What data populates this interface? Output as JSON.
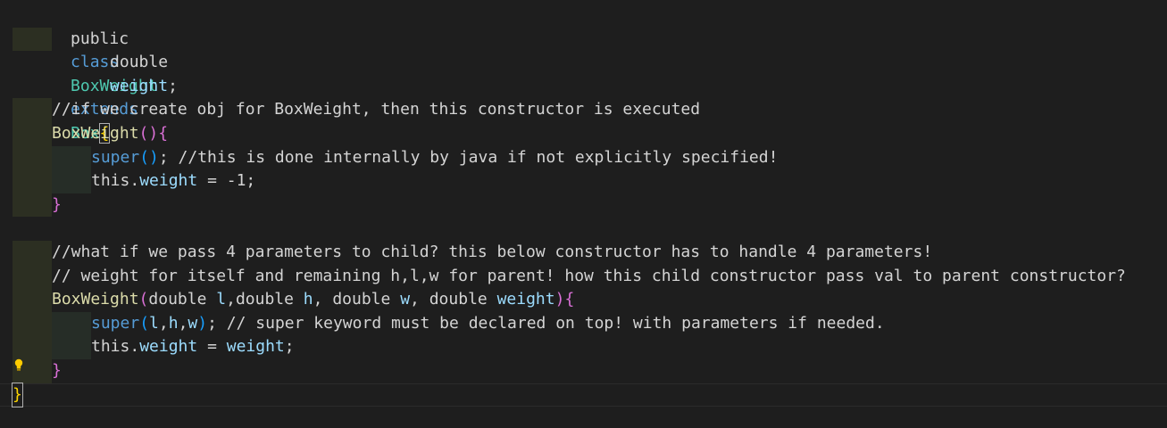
{
  "editor": {
    "lines": {
      "l0": {
        "kw1": "public",
        "kw2": "class",
        "cls": "BoxWeight",
        "kw3": "extends",
        "parent": "Box",
        "brace": "{"
      },
      "l1": {
        "type": "double",
        "name": "weight",
        "end": ";"
      },
      "l2": {},
      "l3": {},
      "l4": {
        "comment": "//if we create obj for BoxWeight, then this constructor is executed"
      },
      "l5": {
        "ctor": "BoxWeight",
        "paren": "()",
        "brace": "{"
      },
      "l6": {
        "super": "super",
        "paren": "()",
        "rest": "; //this is done internally by java if not explicitly specified!"
      },
      "l7": {
        "this": "this",
        "dot": ".",
        "field": "weight",
        "rest": " = -1;"
      },
      "l8": {
        "brace": "}"
      },
      "l9": {},
      "l10": {
        "comment": "//what if we pass 4 parameters to child? this below constructor has to handle 4 parameters!"
      },
      "l11": {
        "comment": "// weight for itself and remaining h,l,w for parent! how this child constructor pass val to parent constructor?"
      },
      "l12": {
        "ctor": "BoxWeight",
        "open": "(",
        "t1": "double ",
        "a1": "l",
        "c1": ",",
        "t2": "double ",
        "a2": "h",
        "c2": ", ",
        "t3": "double ",
        "a3": "w",
        "c3": ", ",
        "t4": "double ",
        "a4": "weight",
        "close": ")",
        "brace": "{"
      },
      "l13": {
        "super": "super",
        "open": "(",
        "a1": "l",
        "c1": ",",
        "a2": "h",
        "c2": ",",
        "a3": "w",
        "close": ")",
        "rest": "; // super keyword must be declared on top! with parameters if needed."
      },
      "l14": {
        "this": "this",
        "dot": ".",
        "field": "weight",
        "eq": " = ",
        "val": "weight",
        "end": ";"
      },
      "l15": {
        "brace": "}"
      },
      "l16": {
        "brace": "}"
      }
    }
  },
  "colors": {
    "background": "#1e1e1e",
    "keyword": "#569cd6",
    "type": "#4ec9b0",
    "function": "#dcdcaa",
    "variable": "#9cdcfe",
    "control": "#c586c0",
    "bracket_gold": "#ffd700",
    "bracket_pink": "#da70d6",
    "bracket_blue": "#179fff"
  },
  "icons": {
    "lightbulb": "lightbulb-icon"
  }
}
